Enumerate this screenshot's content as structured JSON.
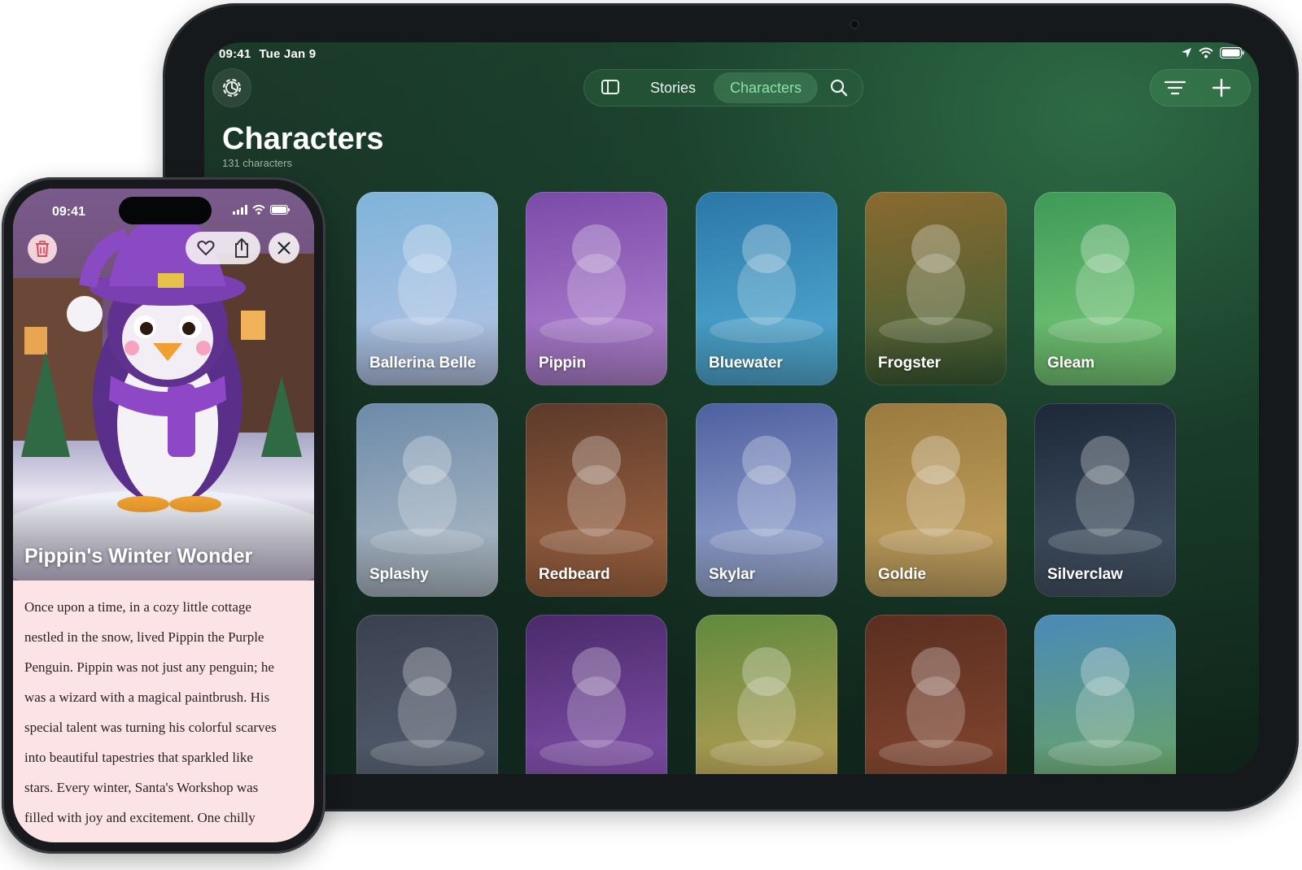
{
  "ipad": {
    "status": {
      "time": "09:41",
      "date": "Tue Jan 9"
    },
    "tabs": {
      "stories": "Stories",
      "characters": "Characters"
    },
    "title": "Characters",
    "subtitle": "131 characters",
    "cards": [
      {
        "name": "",
        "colors": [
          "#c89fb8",
          "#8f6fa0"
        ]
      },
      {
        "name": "Ballerina Belle",
        "colors": [
          "#7fb3d9",
          "#b9c6e6"
        ]
      },
      {
        "name": "Pippin",
        "colors": [
          "#7a4aa8",
          "#b889d6"
        ]
      },
      {
        "name": "Bluewater",
        "colors": [
          "#2b76a8",
          "#56b2d8"
        ]
      },
      {
        "name": "Frogster",
        "colors": [
          "#8a6a30",
          "#3a5d35"
        ]
      },
      {
        "name": "Gleam",
        "colors": [
          "#3e9a58",
          "#7fcf7a"
        ]
      },
      {
        "name": "",
        "colors": [
          "#a0874e",
          "#6b5836"
        ]
      },
      {
        "name": "Splashy",
        "colors": [
          "#6c8aa8",
          "#b5c0c9"
        ]
      },
      {
        "name": "Redbeard",
        "colors": [
          "#5c3a2a",
          "#a86a45"
        ]
      },
      {
        "name": "Skylar",
        "colors": [
          "#4e5fa0",
          "#a3b3d8"
        ]
      },
      {
        "name": "Goldie",
        "colors": [
          "#9a7a3e",
          "#c9a866"
        ]
      },
      {
        "name": "Silverclaw",
        "colors": [
          "#1c2838",
          "#4a5a6c"
        ]
      },
      {
        "name": "",
        "colors": [
          "#2f7890",
          "#3aa0b8"
        ]
      },
      {
        "name": "",
        "colors": [
          "#3a4050",
          "#596474"
        ]
      },
      {
        "name": "",
        "colors": [
          "#4a2a6a",
          "#8a55b5"
        ]
      },
      {
        "name": "",
        "colors": [
          "#5f8a3e",
          "#c9a25a"
        ]
      },
      {
        "name": "",
        "colors": [
          "#5a2e20",
          "#8a4a32"
        ]
      },
      {
        "name": "",
        "colors": [
          "#4a8ab8",
          "#6fa85a"
        ]
      }
    ]
  },
  "iphone": {
    "status": {
      "time": "09:41"
    },
    "story_title": "Pippin's Winter Wonder",
    "story_lines": [
      "Once upon a time, in a cozy little cottage",
      "nestled in the snow, lived Pippin the Purple",
      "Penguin. Pippin was not just any penguin; he",
      "was a wizard with a magical paintbrush. His",
      "special talent was turning his colorful scarves",
      "into beautiful tapestries that sparkled like",
      "stars. Every winter, Santa's Workshop was",
      "filled with joy and excitement. One chilly"
    ]
  },
  "icons": [
    "gear-icon",
    "sidebar-icon",
    "search-icon",
    "filter-icon",
    "plus-icon",
    "trash-icon",
    "heart-icon",
    "share-icon",
    "close-icon",
    "wifi-icon",
    "battery-icon",
    "location-icon",
    "signal-icon"
  ],
  "colors": {
    "accent": "#8ce0a8",
    "background": "#132a20",
    "story_bg": "#fbe3e6"
  }
}
